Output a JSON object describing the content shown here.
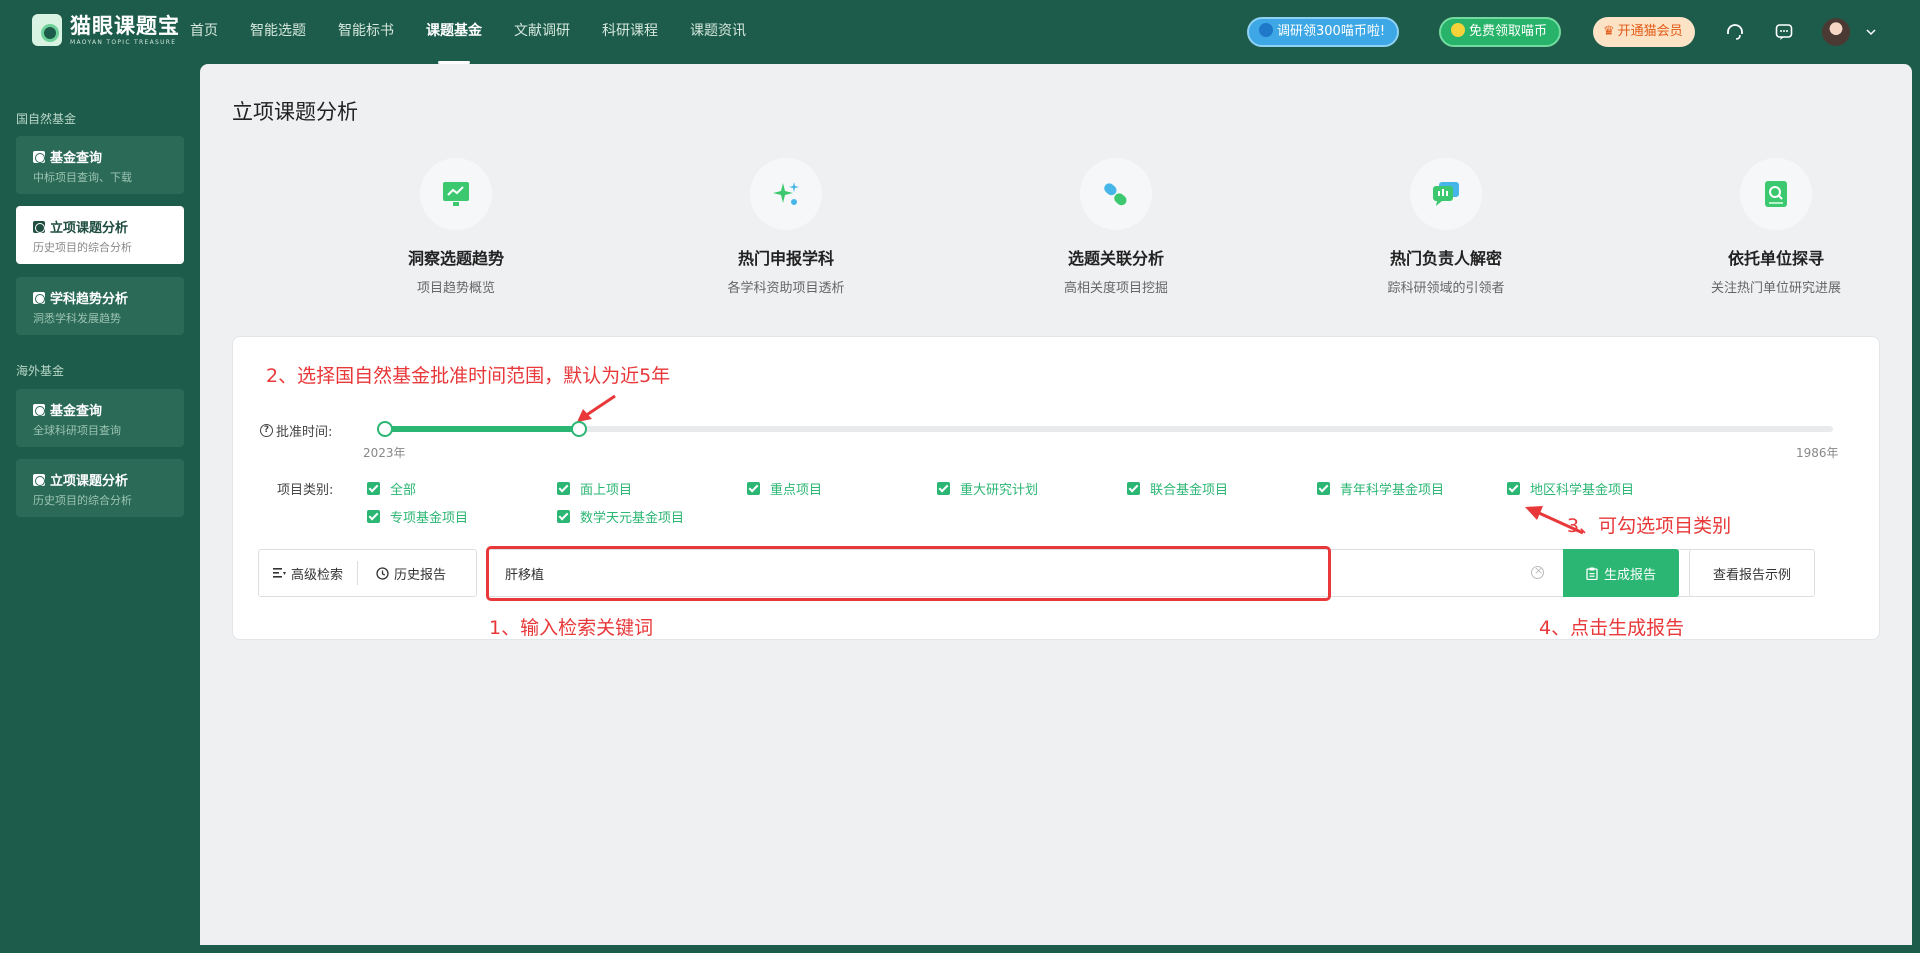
{
  "app": {
    "logo_title": "猫眼课题宝",
    "logo_subtitle": "MAOYAN TOPIC TREASURE"
  },
  "nav": {
    "items": [
      {
        "label": "首页",
        "active": false
      },
      {
        "label": "智能选题",
        "active": false
      },
      {
        "label": "智能标书",
        "active": false
      },
      {
        "label": "课题基金",
        "active": true
      },
      {
        "label": "文献调研",
        "active": false
      },
      {
        "label": "科研课程",
        "active": false
      },
      {
        "label": "课题资讯",
        "active": false
      }
    ],
    "promo_research": "调研领300喵币啦!",
    "promo_coins": "免费领取喵币",
    "promo_vip": "开通猫会员"
  },
  "sidebar": {
    "section1": "国自然基金",
    "section2": "海外基金",
    "items": [
      {
        "title": "基金查询",
        "sub": "中标项目查询、下载",
        "active": false
      },
      {
        "title": "立项课题分析",
        "sub": "历史项目的综合分析",
        "active": true
      },
      {
        "title": "学科趋势分析",
        "sub": "洞悉学科发展趋势",
        "active": false
      },
      {
        "title": "基金查询",
        "sub": "全球科研项目查询",
        "active": false
      },
      {
        "title": "立项课题分析",
        "sub": "历史项目的综合分析",
        "active": false
      }
    ]
  },
  "main": {
    "title": "立项课题分析",
    "features": [
      {
        "title": "洞察选题趋势",
        "sub": "项目趋势概览",
        "icon": "trend-chart-icon"
      },
      {
        "title": "热门申报学科",
        "sub": "各学科资助项目透析",
        "icon": "sparkle-icon"
      },
      {
        "title": "选题关联分析",
        "sub": "高相关度项目挖掘",
        "icon": "link-icon"
      },
      {
        "title": "热门负责人解密",
        "sub": "踪科研领域的引领者",
        "icon": "chat-icon"
      },
      {
        "title": "依托单位探寻",
        "sub": "关注热门单位研究进展",
        "icon": "search-doc-icon"
      }
    ]
  },
  "filter": {
    "time_label": "批准时间:",
    "range_start_label": "2023年",
    "range_end_label": "1986年",
    "range_selected_fraction": 0.134,
    "category_label": "项目类别:",
    "categories": [
      {
        "label": "全部",
        "checked": true
      },
      {
        "label": "面上项目",
        "checked": true
      },
      {
        "label": "重点项目",
        "checked": true
      },
      {
        "label": "重大研究计划",
        "checked": true
      },
      {
        "label": "联合基金项目",
        "checked": true
      },
      {
        "label": "青年科学基金项目",
        "checked": true
      },
      {
        "label": "地区科学基金项目",
        "checked": true
      },
      {
        "label": "专项基金项目",
        "checked": true
      },
      {
        "label": "数学天元基金项目",
        "checked": true
      }
    ]
  },
  "search": {
    "advanced_label": "高级检索",
    "history_label": "历史报告",
    "value": "肝移植",
    "generate_label": "生成报告",
    "example_label": "查看报告示例"
  },
  "annotations": {
    "step1": "1、输入检索关键词",
    "step2": "2、选择国自然基金批准时间范围，默认为近5年",
    "step3": "3、可勾选项目类别",
    "step4": "4、点击生成报告"
  },
  "colors": {
    "brand": "#1d5c4a",
    "accent": "#2bb673",
    "annotation": "#e8383a"
  }
}
